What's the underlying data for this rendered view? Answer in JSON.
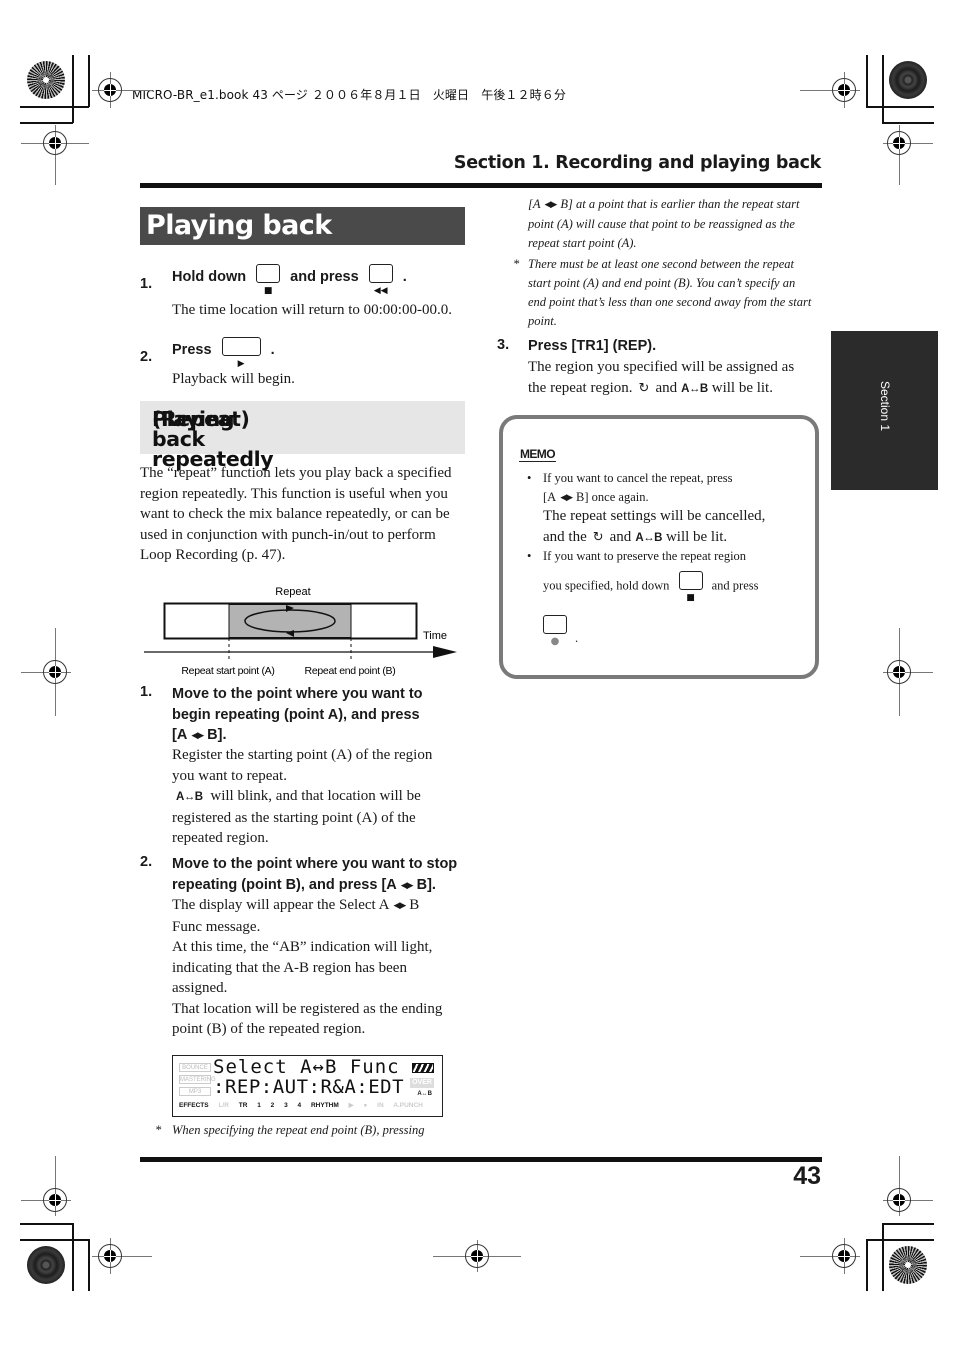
{
  "print_header": "MICRO-BR_e1.book 43 ページ ２００６年８月１日　火曜日　午後１２時６分",
  "running_header": "Section 1. Recording and playing back",
  "side_tab": "Section 1",
  "page_number": "43",
  "playing_back": {
    "title": "Playing back",
    "steps": [
      {
        "num": "1.",
        "pre": "Hold down",
        "button1_glyph": "■",
        "mid": "and press",
        "button2_glyph": "◀◀",
        "post": ".",
        "body": "The time location will return to 00:00:00-00.0."
      },
      {
        "num": "2.",
        "pre": "Press",
        "button1_glyph": "▶",
        "post": ".",
        "body": "Playback will begin."
      }
    ]
  },
  "repeat": {
    "title_line1": "Playing back repeatedly",
    "title_line2": "(Repeat)",
    "intro": "The “repeat” function lets you play back a specified region repeatedly. This function is useful when you want to check the mix balance repeatedly, or can be used in conjunction with punch-in/out to perform Loop Recording (p. 47).",
    "diagram": {
      "label_repeat": "Repeat",
      "label_time": "Time",
      "label_start": "Repeat start point (A)",
      "label_end": "Repeat end point (B)"
    },
    "steps": [
      {
        "num": "1.",
        "title_l1": "Move to the point where you want to",
        "title_l2": "begin repeating (point A), and press",
        "title_l3_a": "[A",
        "title_l3_b": "B].",
        "body_l1": "Register the starting point (A) of the region",
        "body_l2": "you want to repeat.",
        "body_l3": "will blink, and that location will be",
        "body_l4": "registered as the starting point (A) of the",
        "body_l5": "repeated region."
      },
      {
        "num": "2.",
        "title_l1": "Move to the point where you want to stop",
        "title_l2_a": "repeating (point B), and press [A",
        "title_l2_b": "B].",
        "body_l1_a": "The display will appear the Select A",
        "body_l1_b": "B",
        "body_l2": "Func message.",
        "body_l3": "At this time, the “AB” indication will light,",
        "body_l4": "indicating that the A-B region has been",
        "body_l5": "assigned.",
        "body_l6": "That location will be registered as the ending",
        "body_l7": "point (B) of the repeated region."
      },
      {
        "num": "3.",
        "title": "Press [TR1] (REP).",
        "body_l1": "The region you specified will be assigned as",
        "body_l2_a": "the repeat region.",
        "body_l2_b": "and",
        "body_l2_c": "will be lit."
      }
    ],
    "lcd": {
      "line1": "Select A↔B Func",
      "line2": ":REP:AUT:R&A:EDT",
      "side_labels": [
        "BOUNCE",
        "MASTERING",
        "MP3"
      ],
      "bottom_labels": [
        "EFFECTS",
        "L/R",
        "TR",
        "1",
        "2",
        "3",
        "4",
        "RHYTHM",
        "▶",
        "●",
        "IN",
        "A.PUNCH"
      ],
      "over": "OVER",
      "ab": "A↔B"
    },
    "note_bottom": "When specifying the repeat end point (B), pressing",
    "note_continued_l1_a": "[A",
    "note_continued_l1_b": "B] at a point that is earlier than the repeat start",
    "note_continued_l2": "point (A) will cause that point to be reassigned as the",
    "note_continued_l3": "repeat start point (A).",
    "note2_l1": "There must be at least one second between the repeat",
    "note2_l2": "start point (A) and end point (B). You can’t specify an",
    "note2_l3": "end point that’s less than one second away from the start",
    "note2_l4": "point.",
    "note_star": "*"
  },
  "memo": {
    "label": "MEMO",
    "bullet1_l1": "If you want to cancel the repeat, press",
    "bullet1_l2_a": "[A",
    "bullet1_l2_b": "B] once again.",
    "cancel_l1": "The repeat settings will be cancelled,",
    "cancel_l2_a": "and the",
    "cancel_l2_b": "and",
    "cancel_l2_c": "will be lit.",
    "bullet2_l1": "If you want to preserve the repeat region",
    "bullet2_l2_a": "you specified, hold down",
    "bullet2_l2_b": "and press",
    "stop_glyph": "■",
    "rec_glyph": "●",
    "period": "."
  },
  "icons": {
    "ab_arrows": "◀▶",
    "ab_indicator": "A↔B",
    "loop": "↻"
  }
}
